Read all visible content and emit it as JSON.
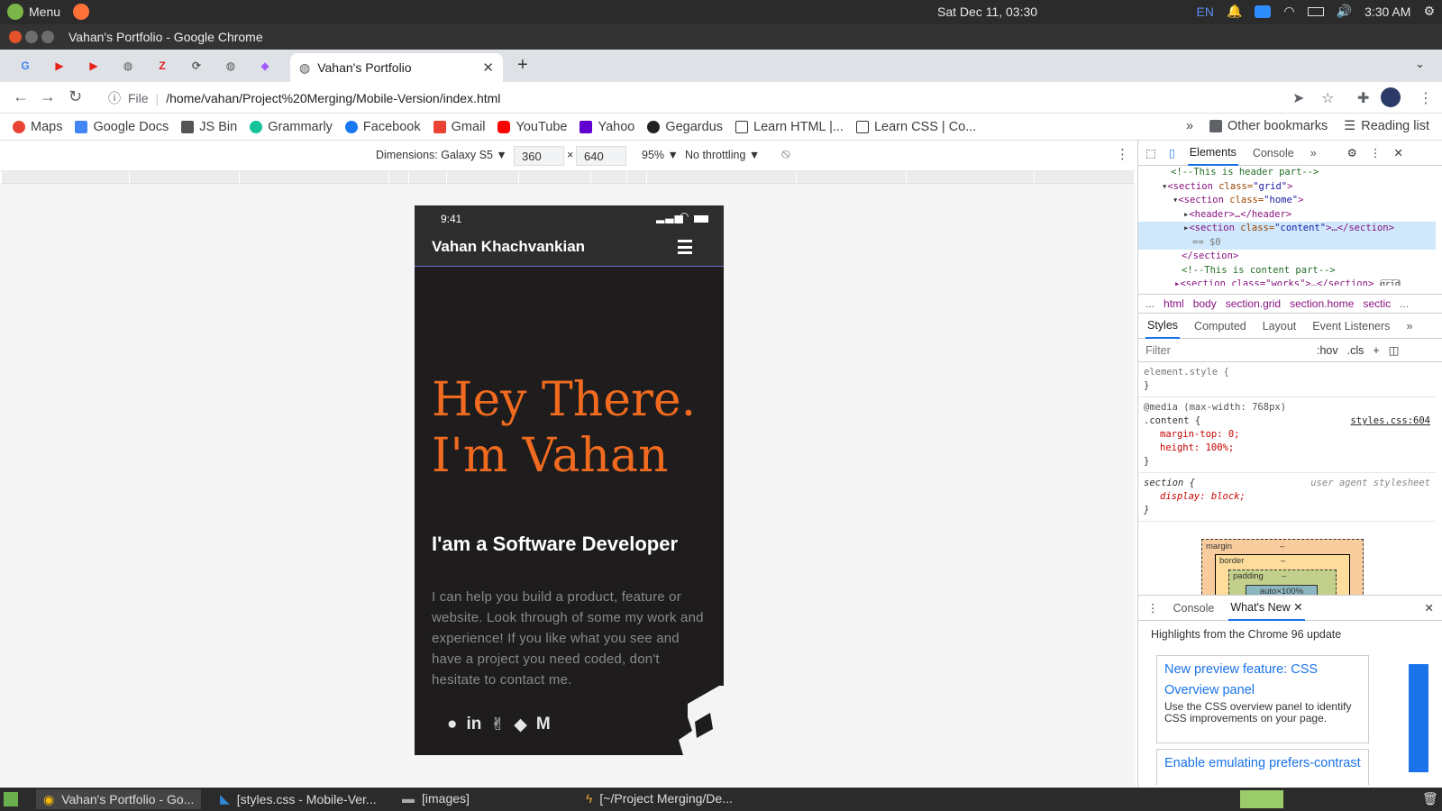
{
  "system": {
    "menu_label": "Menu",
    "clock": "Sat Dec 11, 03:30",
    "lang": "EN",
    "time": "3:30 AM"
  },
  "window": {
    "title": "Vahan's Portfolio - Google Chrome"
  },
  "tabs": {
    "active_title": "Vahan's Portfolio",
    "new_tab": "+"
  },
  "address": {
    "scheme_label": "File",
    "url": "/home/vahan/Project%20Merging/Mobile-Version/index.html"
  },
  "bookmarks": {
    "items": [
      "Maps",
      "Google Docs",
      "JS Bin",
      "Grammarly",
      "Facebook",
      "Gmail",
      "YouTube",
      "Yahoo",
      "Gegardus",
      "Learn HTML |...",
      "Learn CSS | Co..."
    ],
    "overflow": "»",
    "other": "Other bookmarks",
    "reading": "Reading list"
  },
  "device": {
    "dimensions": "Dimensions: Galaxy S5 ▼",
    "width": "360",
    "x": "×",
    "height": "640",
    "zoom": "95% ▼",
    "throttle": "No throttling ▼"
  },
  "page": {
    "status_time": "9:41",
    "brand": "Vahan Khachvankian",
    "hero_line1": "Hey There.",
    "hero_line2": "I'm Vahan",
    "role": "I'am a Software Developer",
    "description": "I can help you build a product, feature or website. Look through of some my work and experience! If you like what you see and have a project you need coded, don't hesitate to contact me.",
    "socials": [
      "M"
    ]
  },
  "devtools": {
    "tabs": [
      "Elements",
      "Console",
      "»"
    ],
    "dom": {
      "l1": "<!--This is header part-->",
      "l2_tag": "<section ",
      "l2_attr": "class=",
      "l2_val": "\"grid\"",
      "l2_end": ">",
      "l3_tag": "<section ",
      "l3_attr": "class=",
      "l3_val": "\"home\"",
      "l3_end": ">",
      "l4": "<header>…</header>",
      "l5_tag": "<section ",
      "l5_attr": "class=",
      "l5_val": "\"content\"",
      "l5_end": ">…</section>",
      "l6": "== $0",
      "l7": "</section>",
      "l8": "<!--This is content part-->",
      "l9": "<section class=\"works\">…</section>",
      "l9_badge": "grid"
    },
    "crumbs": [
      "...",
      "html",
      "body",
      "section.grid",
      "section.home",
      "sectic",
      "..."
    ],
    "subtabs": [
      "Styles",
      "Computed",
      "Layout",
      "Event Listeners",
      "»"
    ],
    "filter_placeholder": "Filter",
    "hov": ":hov",
    "cls": ".cls",
    "styles": {
      "r1": "element.style {",
      "close": "}",
      "media": "@media (max-width: 768px)",
      "sel": ".content {",
      "src": "styles.css:604",
      "p1": "margin-top: 0;",
      "p2": "height: 100%;",
      "sel2": "section {",
      "ua": "user agent stylesheet",
      "p3": "display: block;"
    },
    "box": {
      "margin": "margin",
      "border": "border",
      "padding": "padding",
      "content": "auto×100%",
      "dash": "–"
    },
    "drawer": {
      "tabs": [
        "Console",
        "What's New"
      ],
      "highlights": "Highlights from the Chrome 96 update",
      "card1_title": "New preview feature: CSS Overview panel",
      "card1_body": "Use the CSS overview panel to identify CSS improvements on your page.",
      "card2_title": "Enable emulating prefers-contrast"
    }
  },
  "taskbar": {
    "items": [
      "Vahan's Portfolio - Go...",
      "[styles.css - Mobile-Ver...",
      "[images]",
      "[~/Project Merging/De..."
    ]
  }
}
